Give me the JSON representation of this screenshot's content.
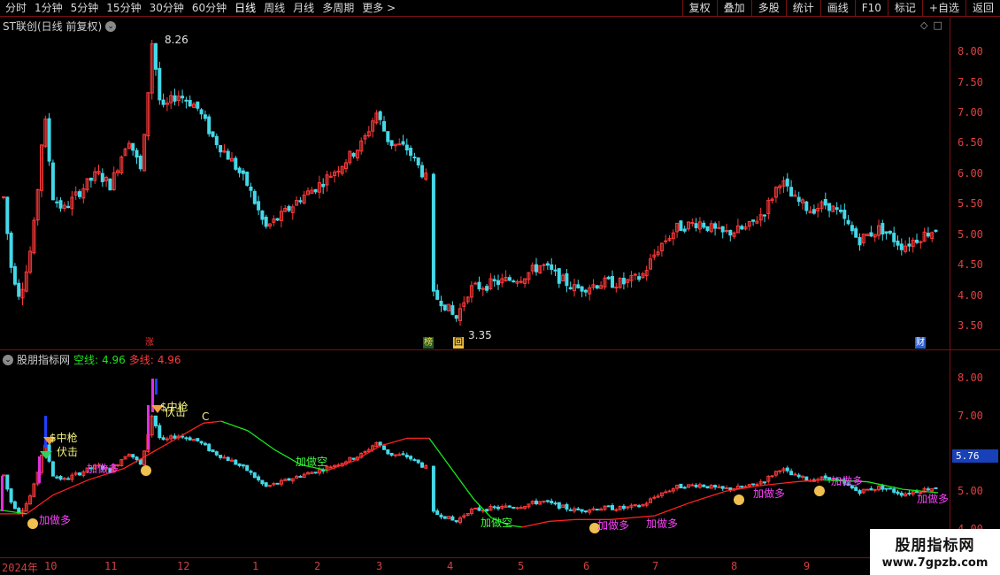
{
  "toolbar": {
    "periods": [
      "分时",
      "1分钟",
      "5分钟",
      "15分钟",
      "30分钟",
      "60分钟",
      "日线",
      "周线",
      "月线",
      "多周期",
      "更多 >"
    ],
    "active_period": "日线",
    "actions": [
      "复权",
      "叠加",
      "多股",
      "统计",
      "画线",
      "F10",
      "标记",
      "+自选",
      "返回"
    ]
  },
  "main": {
    "title": "ST联创(日线 前复权)",
    "high_label": "8.26",
    "low_label": "3.35",
    "axis_ticks": [
      "8.00",
      "7.50",
      "7.00",
      "6.50",
      "6.00",
      "5.50",
      "5.00",
      "4.50",
      "4.00",
      "3.50"
    ],
    "markers": [
      {
        "text": "涨",
        "color": "#ff3030"
      },
      {
        "text": "榜",
        "color": "#e0c040"
      },
      {
        "text": "回",
        "color": "#f0c040"
      },
      {
        "text": "财",
        "color": "#60a0ff"
      }
    ]
  },
  "indicator": {
    "name": "股朋指标网",
    "kong_label": "空线:",
    "kong_value": "4.96",
    "duo_label": "多线:",
    "duo_value": "4.96",
    "axis_ticks": [
      "8.00",
      "7.00",
      "6.00",
      "5.00",
      "4.00"
    ],
    "current_price": "5.76",
    "annotations": [
      "$中枪",
      "伏击",
      "加做多",
      "加做空",
      "C"
    ]
  },
  "dates": {
    "labels": [
      "2024年",
      "10",
      "11",
      "12",
      "1",
      "2",
      "3",
      "4",
      "5",
      "6",
      "7",
      "8",
      "9"
    ]
  },
  "watermark": {
    "line1": "股朋指标网",
    "line2": "www.7gpzb.com"
  },
  "colors": {
    "up": "#ff3a3a",
    "down": "#44d8e8",
    "kong_line": "#19e619",
    "duo_line": "#ff2020",
    "axis": "#7a1010"
  }
}
